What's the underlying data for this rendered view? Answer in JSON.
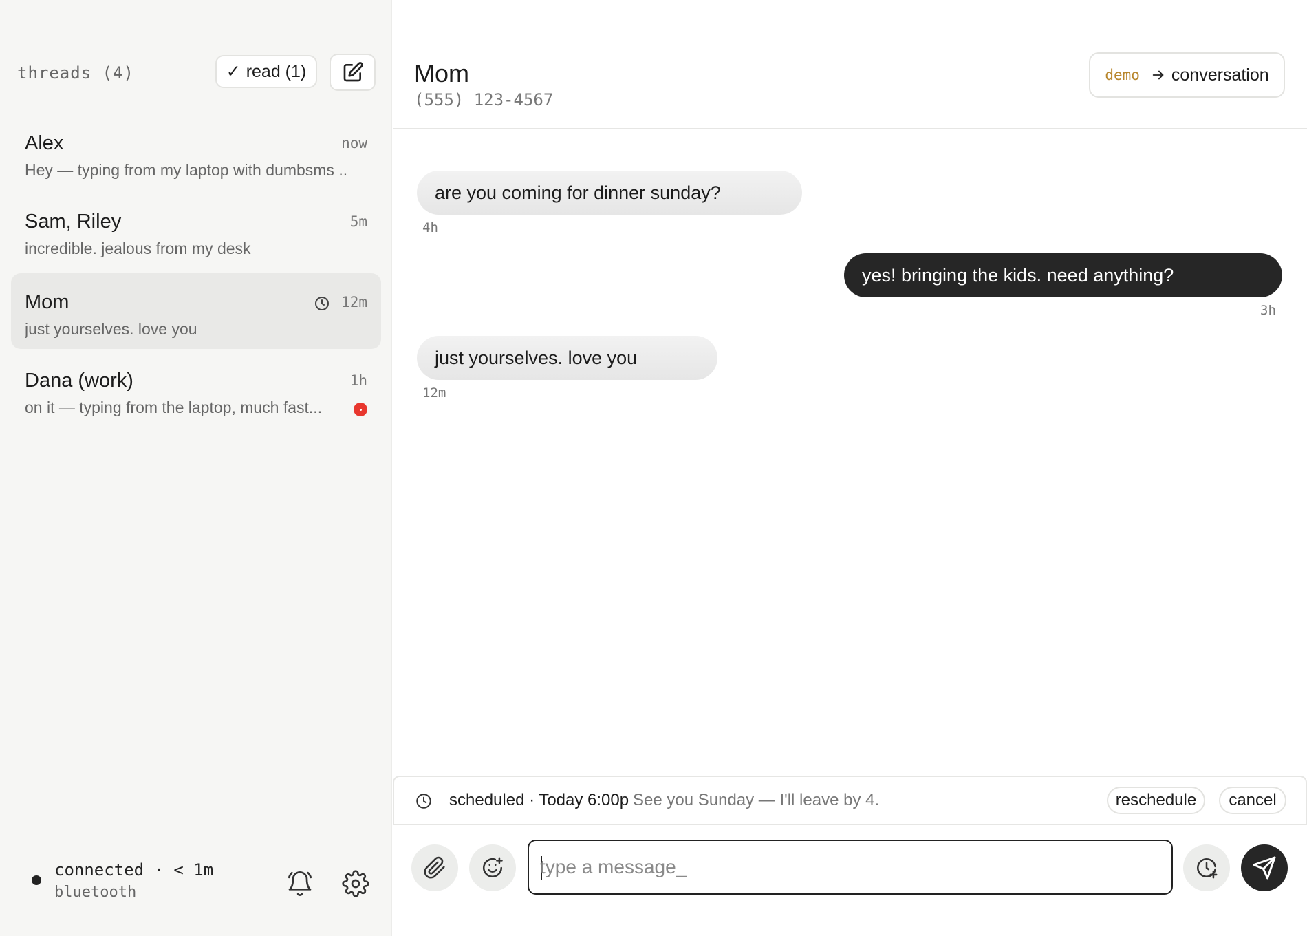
{
  "sidebar": {
    "title": "threads (4)",
    "read_button": {
      "check": "✓",
      "label": "read (1)"
    },
    "threads": [
      {
        "name": "Alex",
        "time": "now",
        "preview": "Hey — typing from my laptop with dumbsms ...",
        "active": false,
        "unread": false,
        "scheduled": false
      },
      {
        "name": "Sam, Riley",
        "time": "5m",
        "preview": "incredible. jealous from my desk",
        "active": false,
        "unread": false,
        "scheduled": false
      },
      {
        "name": "Mom",
        "time": "12m",
        "preview": "just yourselves. love you",
        "active": true,
        "unread": false,
        "scheduled": true
      },
      {
        "name": "Dana (work)",
        "time": "1h",
        "preview": "on it — typing from the laptop, much fast...",
        "active": false,
        "unread": true,
        "scheduled": false
      }
    ],
    "footer": {
      "status": "connected · < 1m",
      "transport": "bluetooth"
    }
  },
  "conversation": {
    "contact_name": "Mom",
    "contact_phone": "(555) 123-4567",
    "demo_button": {
      "tag": "demo",
      "label": "conversation"
    },
    "messages": [
      {
        "direction": "in",
        "text": "are you coming for dinner sunday?",
        "time": "4h"
      },
      {
        "direction": "out",
        "text": "yes! bringing the kids. need anything?",
        "time": "3h"
      },
      {
        "direction": "in",
        "text": "just yourselves. love you",
        "time": "12m"
      }
    ]
  },
  "scheduled": {
    "label": "scheduled · Today 6:00p",
    "message": "See you Sunday — I'll leave by 4.",
    "reschedule_label": "reschedule",
    "cancel_label": "cancel"
  },
  "composer": {
    "placeholder": "type a message_"
  },
  "colors": {
    "sidebar_bg": "#f6f6f4",
    "active_thread_bg": "#e9e9e7",
    "outgoing_bubble": "#262626",
    "incoming_bubble": "#ececec",
    "unread_badge": "#e8372e",
    "demo_accent": "#b8862c"
  },
  "icons": {
    "compose": "compose-icon",
    "clock": "clock-icon",
    "bell": "bell-icon",
    "gear": "gear-icon",
    "attach": "paperclip-icon",
    "emoji": "emoji-add-icon",
    "schedule": "clock-plus-icon",
    "send": "send-icon",
    "arrow": "arrow-right-icon"
  }
}
